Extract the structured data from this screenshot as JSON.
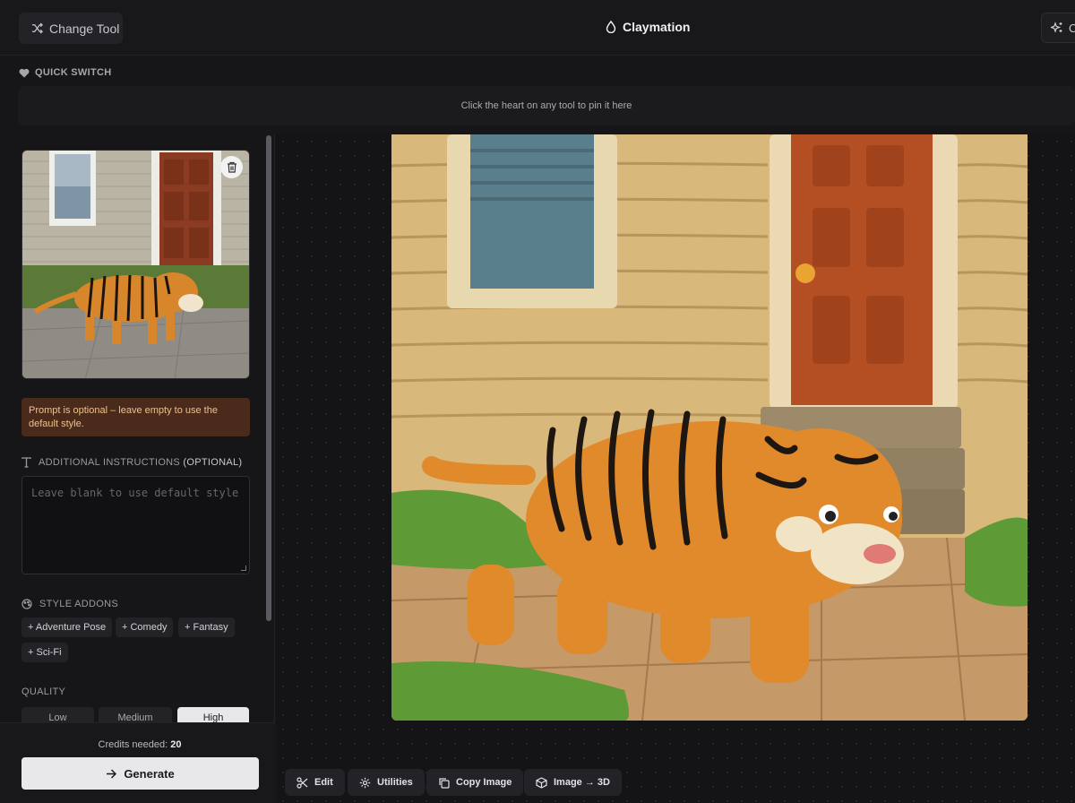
{
  "header": {
    "change_tool_label": "Change Tool",
    "title": "Claymation",
    "right_button_label": "C"
  },
  "quick_switch": {
    "label": "QUICK SWITCH",
    "empty_text": "Click the heart on any tool to pin it here"
  },
  "sidebar": {
    "notice": "Prompt is optional – leave empty to use the default style.",
    "instructions_label": "ADDITIONAL INSTRUCTIONS",
    "instructions_optional": "(OPTIONAL)",
    "instructions_placeholder": "Leave blank to use default style",
    "style_addons_label": "STYLE ADDONS",
    "addons": [
      "+ Adventure Pose",
      "+ Comedy",
      "+ Fantasy",
      "+ Sci-Fi"
    ],
    "quality_label": "QUALITY",
    "quality_options": [
      "Low",
      "Medium",
      "High"
    ],
    "quality_selected": "High",
    "credits_prefix": "Credits needed:",
    "credits_value": "20",
    "generate_label": "Generate"
  },
  "toolbar": {
    "edit": "Edit",
    "utilities": "Utilities",
    "copy_image": "Copy Image",
    "image_to_3d": "Image → 3D"
  },
  "colors": {
    "notice_bg": "#4a2a1a",
    "notice_text": "#f0c08c",
    "generate_bg": "#e8e8ea"
  }
}
